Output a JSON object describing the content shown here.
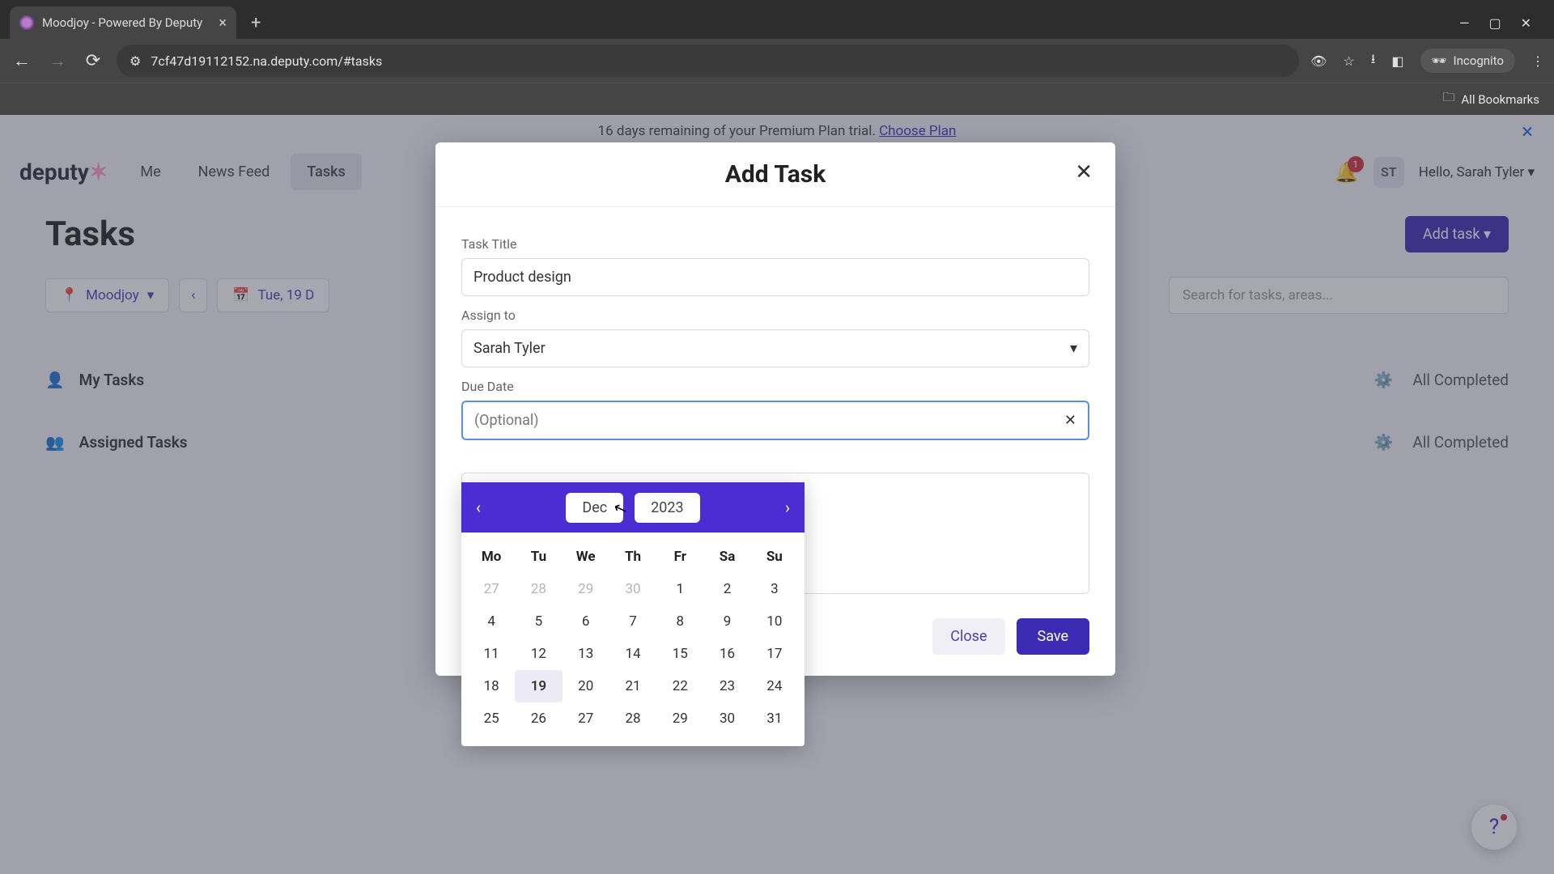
{
  "browser": {
    "tab_title": "Moodjoy - Powered By Deputy",
    "url": "7cf47d19112152.na.deputy.com/#tasks",
    "incognito_label": "Incognito",
    "all_bookmarks": "All Bookmarks"
  },
  "banner": {
    "text_prefix": "16 days remaining of your Premium Plan trial. ",
    "link": "Choose Plan"
  },
  "header": {
    "logo": "deputy",
    "nav": [
      "Me",
      "News Feed",
      "Tasks"
    ],
    "active_nav_index": 2,
    "notification_count": "1",
    "avatar_initials": "ST",
    "greeting": "Hello, Sarah Tyler"
  },
  "page_title": "Tasks",
  "add_task_button": "Add task",
  "filters": {
    "org": "Moodjoy",
    "date": "Tue, 19 D",
    "search_placeholder": "Search for tasks, areas..."
  },
  "task_sections": [
    {
      "label": "My Tasks",
      "status": "All Completed"
    },
    {
      "label": "Assigned Tasks",
      "status": "All Completed"
    }
  ],
  "modal": {
    "title": "Add Task",
    "fields": {
      "title_label": "Task Title",
      "title_value": "Product design",
      "assign_label": "Assign to",
      "assign_value": "Sarah Tyler",
      "due_label": "Due Date",
      "due_placeholder": "(Optional)"
    },
    "buttons": {
      "close": "Close",
      "save": "Save"
    }
  },
  "calendar": {
    "month": "Dec",
    "year": "2023",
    "dow": [
      "Mo",
      "Tu",
      "We",
      "Th",
      "Fr",
      "Sa",
      "Su"
    ],
    "weeks": [
      [
        {
          "n": "27",
          "o": true
        },
        {
          "n": "28",
          "o": true
        },
        {
          "n": "29",
          "o": true
        },
        {
          "n": "30",
          "o": true
        },
        {
          "n": "1"
        },
        {
          "n": "2"
        },
        {
          "n": "3"
        }
      ],
      [
        {
          "n": "4"
        },
        {
          "n": "5"
        },
        {
          "n": "6"
        },
        {
          "n": "7"
        },
        {
          "n": "8"
        },
        {
          "n": "9"
        },
        {
          "n": "10"
        }
      ],
      [
        {
          "n": "11"
        },
        {
          "n": "12"
        },
        {
          "n": "13"
        },
        {
          "n": "14"
        },
        {
          "n": "15"
        },
        {
          "n": "16"
        },
        {
          "n": "17"
        }
      ],
      [
        {
          "n": "18"
        },
        {
          "n": "19",
          "t": true
        },
        {
          "n": "20"
        },
        {
          "n": "21"
        },
        {
          "n": "22"
        },
        {
          "n": "23"
        },
        {
          "n": "24"
        }
      ],
      [
        {
          "n": "25"
        },
        {
          "n": "26"
        },
        {
          "n": "27"
        },
        {
          "n": "28"
        },
        {
          "n": "29"
        },
        {
          "n": "30"
        },
        {
          "n": "31"
        }
      ]
    ]
  },
  "colors": {
    "accent": "#4b2ed3",
    "primary_btn": "#3c2bb3"
  }
}
